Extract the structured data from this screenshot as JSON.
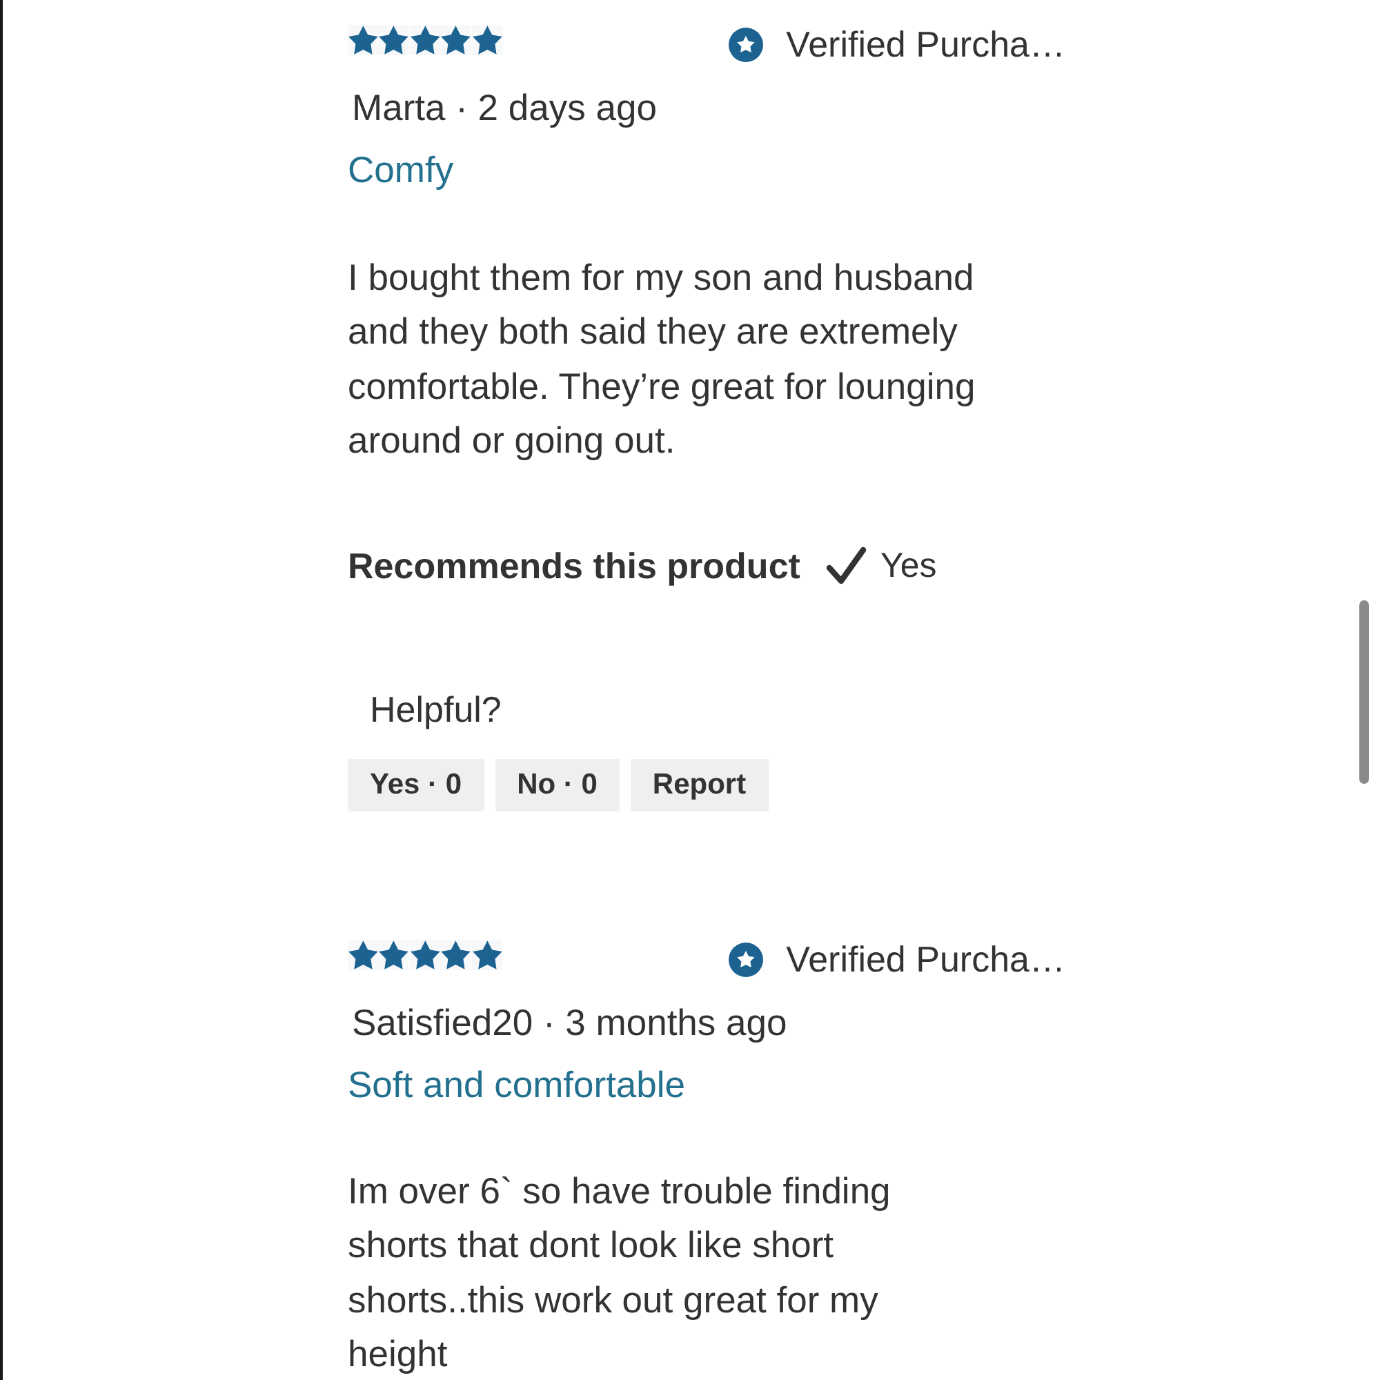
{
  "reviews": [
    {
      "stars": 5,
      "verified": "Verified Purcha…",
      "byline": "Marta · 2 days ago",
      "title": "Comfy",
      "body": "I bought them for my son and husband\nand they both said they are extremely\ncomfortable. They’re great for lounging\naround or going out.",
      "recommends": {
        "label": "Recommends this product",
        "value": "Yes"
      },
      "helpful": {
        "label": "Helpful?",
        "buttons": [
          "Yes · 0",
          "No · 0",
          "Report"
        ]
      }
    },
    {
      "stars": 5,
      "verified": "Verified Purcha…",
      "byline": "Satisfied20 · 3 months ago",
      "title": "Soft and comfortable",
      "body": "Im over 6` so have trouble finding\nshorts that dont look like short\nshorts..this work out great for my\nheight"
    }
  ]
}
